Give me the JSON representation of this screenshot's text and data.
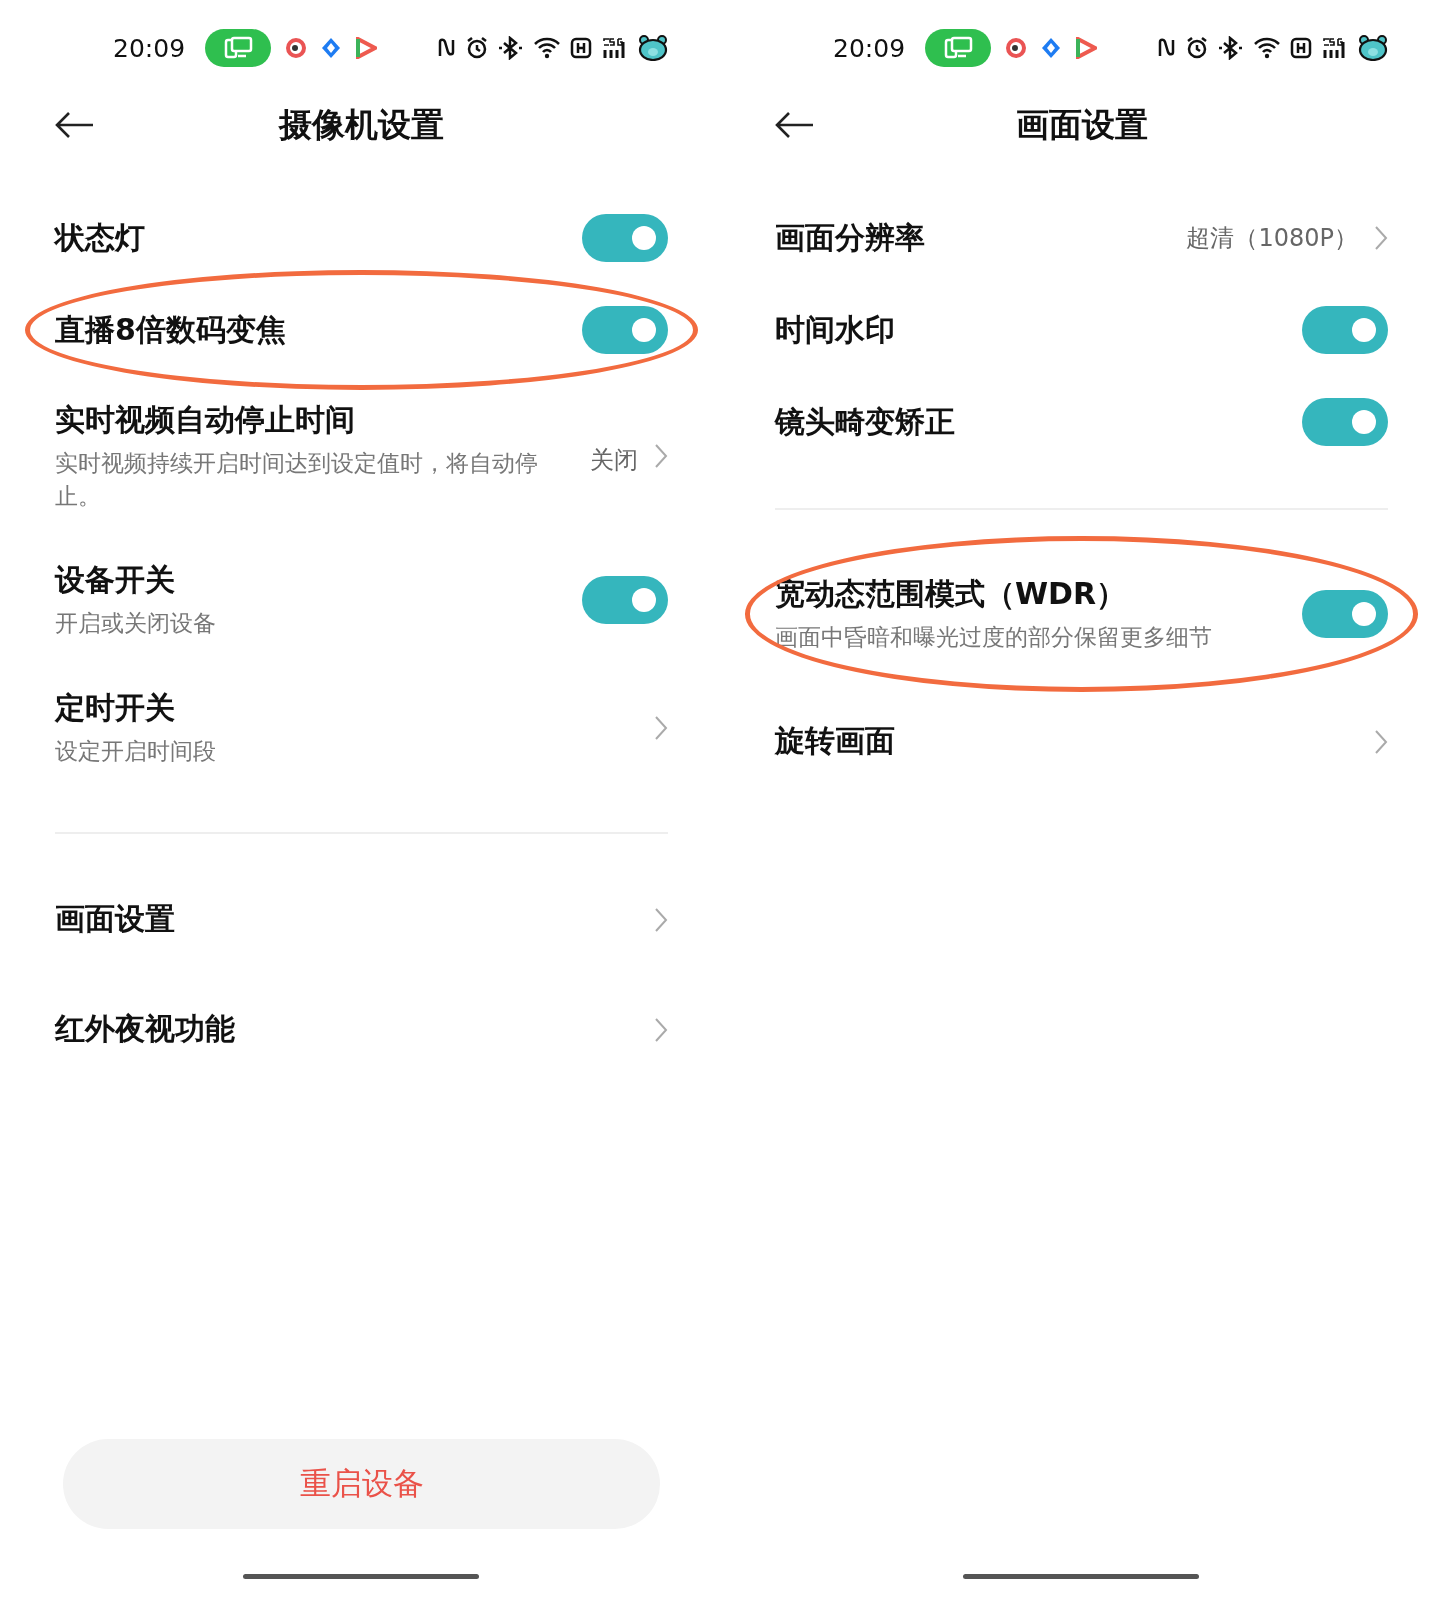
{
  "screens": [
    {
      "status_bar": {
        "time": "20:09"
      },
      "title": "摄像机设置",
      "groups": [
        [
          {
            "kind": "toggle",
            "label": "状态灯",
            "on": true,
            "highlighted": false
          },
          {
            "kind": "toggle",
            "label": "直播8倍数码变焦",
            "on": true,
            "highlighted": true
          },
          {
            "kind": "link",
            "label": "实时视频自动停止时间",
            "description": "实时视频持续开启时间达到设定值时，将自动停止。",
            "value": "关闭",
            "highlighted": false
          },
          {
            "kind": "toggle",
            "label": "设备开关",
            "description": "开启或关闭设备",
            "on": true,
            "highlighted": false
          },
          {
            "kind": "link",
            "label": "定时开关",
            "description": "设定开启时间段",
            "highlighted": false
          }
        ],
        [
          {
            "kind": "link",
            "label": "画面设置",
            "highlighted": false
          },
          {
            "kind": "link",
            "label": "红外夜视功能",
            "highlighted": false
          }
        ]
      ],
      "button": "重启设备"
    },
    {
      "status_bar": {
        "time": "20:09"
      },
      "title": "画面设置",
      "groups": [
        [
          {
            "kind": "link",
            "label": "画面分辨率",
            "value": "超清（1080P）",
            "highlighted": false
          },
          {
            "kind": "toggle",
            "label": "时间水印",
            "on": true,
            "highlighted": false
          },
          {
            "kind": "toggle",
            "label": "镜头畸变矫正",
            "on": true,
            "highlighted": false
          }
        ],
        [
          {
            "kind": "toggle",
            "label": "宽动态范围模式（WDR）",
            "description": "画面中昏暗和曝光过度的部分保留更多细节",
            "on": true,
            "highlighted": true
          },
          {
            "kind": "link",
            "label": "旋转画面",
            "highlighted": false
          }
        ]
      ]
    }
  ]
}
